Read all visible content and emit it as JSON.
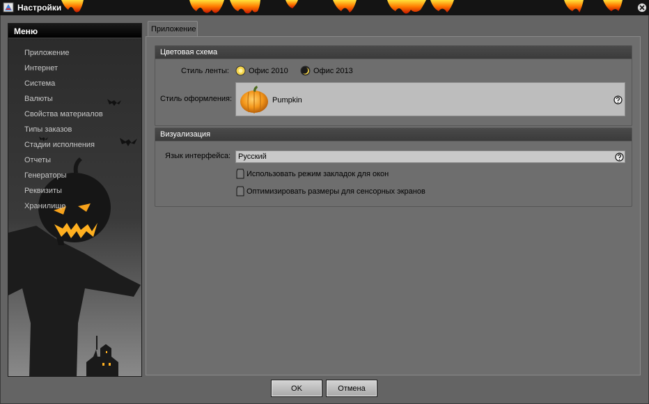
{
  "window": {
    "title": "Настройки"
  },
  "sidebar": {
    "header": "Меню",
    "items": [
      {
        "label": "Приложение"
      },
      {
        "label": "Интернет"
      },
      {
        "label": "Система"
      },
      {
        "label": "Валюты"
      },
      {
        "label": "Свойства материалов"
      },
      {
        "label": "Типы заказов"
      },
      {
        "label": "Стадии исполнения"
      },
      {
        "label": "Отчеты"
      },
      {
        "label": "Генераторы"
      },
      {
        "label": "Реквизиты"
      },
      {
        "label": "Хранилище"
      }
    ]
  },
  "tabs": [
    {
      "label": "Приложение",
      "selected": true
    }
  ],
  "color_scheme": {
    "header": "Цветовая схема",
    "ribbon_style_label": "Стиль ленты:",
    "ribbon_options": [
      {
        "label": "Офис 2010",
        "icon": "sun-icon"
      },
      {
        "label": "Офис 2013",
        "icon": "moon-icon"
      }
    ],
    "theme_label": "Стиль оформления:",
    "theme_value": "Pumpkin"
  },
  "visualization": {
    "header": "Визуализация",
    "language_label": "Язык интерфейса:",
    "language_value": "Русский",
    "checkboxes": [
      {
        "label": "Использовать режим закладок для окон",
        "checked": false
      },
      {
        "label": "Оптимизировать размеры для сенсорных экранов",
        "checked": false
      }
    ]
  },
  "buttons": {
    "ok": "OK",
    "cancel": "Отмена"
  },
  "colors": {
    "flame": "#ff8a00",
    "pumpkin": "#f39a1b",
    "background": "#6e6e6e"
  }
}
